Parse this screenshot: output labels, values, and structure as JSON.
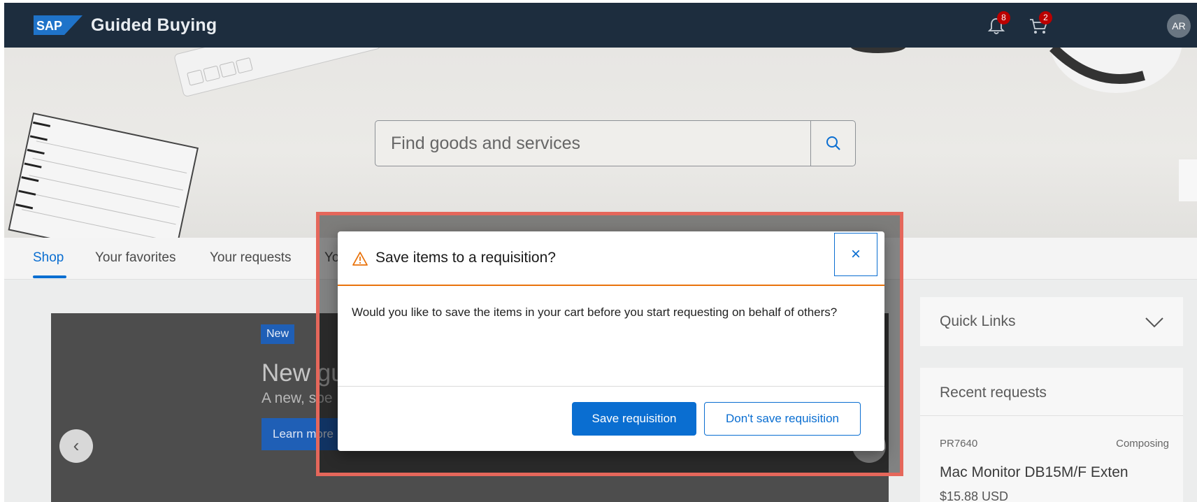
{
  "header": {
    "logo_text": "SAP",
    "app_title": "Guided Buying",
    "notifications_count": "8",
    "cart_count": "2",
    "user_initials": "AR"
  },
  "search": {
    "placeholder": "Find goods and services"
  },
  "tabs": [
    {
      "label": "Shop",
      "active": true
    },
    {
      "label": "Your favorites"
    },
    {
      "label": "Your requests"
    },
    {
      "label": "Yo"
    }
  ],
  "banner": {
    "badge": "New",
    "title": "New gu",
    "subtitle": "A new, spe",
    "learn_more": "Learn more"
  },
  "quick_links": {
    "title": "Quick Links"
  },
  "recent_requests": {
    "title": "Recent requests",
    "items": [
      {
        "id": "PR7640",
        "status": "Composing",
        "name": "Mac Monitor DB15M/F Exten",
        "price": "$15.88 USD"
      }
    ]
  },
  "dialog": {
    "title": "Save items to a requisition?",
    "close_label": "×",
    "message": "Would you like to save the items in your cart before you start requesting on behalf of others?",
    "primary_button": "Save requisition",
    "secondary_button": "Don't save requisition"
  },
  "colors": {
    "shell": "#1d2d3e",
    "accent": "#0a6ed1",
    "warning": "#e9730c",
    "highlight": "#e5675b"
  }
}
